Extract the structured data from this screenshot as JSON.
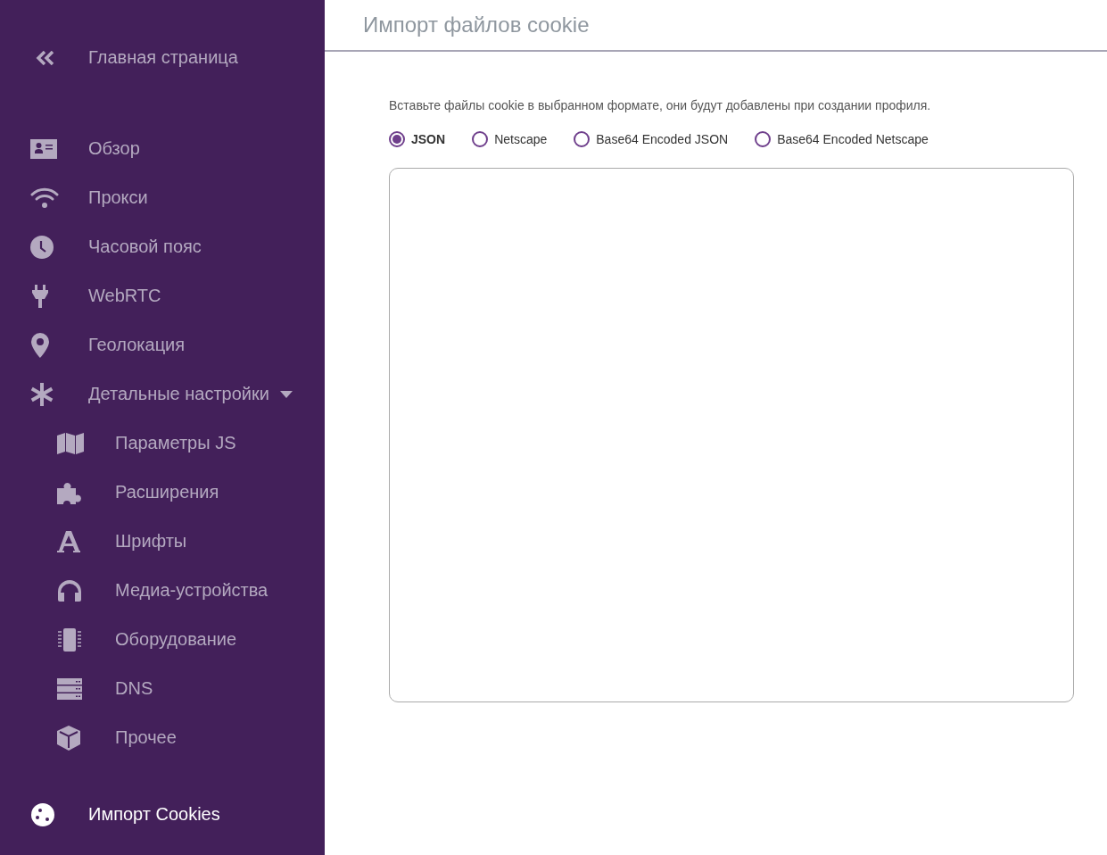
{
  "sidebar": {
    "back": {
      "label": "Главная страница"
    },
    "items": [
      {
        "label": "Обзор",
        "selected": false
      },
      {
        "label": "Прокси",
        "selected": false
      },
      {
        "label": "Часовой пояс",
        "selected": false
      },
      {
        "label": "WebRTC",
        "selected": false
      },
      {
        "label": "Геолокация",
        "selected": false
      },
      {
        "label": "Детальные настройки",
        "selected": false,
        "expanded": true,
        "children": [
          {
            "label": "Параметры JS",
            "selected": false
          },
          {
            "label": "Расширения",
            "selected": false
          },
          {
            "label": "Шрифты",
            "selected": false
          },
          {
            "label": "Медиа-устройства",
            "selected": false
          },
          {
            "label": "Оборудование",
            "selected": false
          },
          {
            "label": "DNS",
            "selected": false
          },
          {
            "label": "Прочее",
            "selected": false
          }
        ]
      }
    ],
    "bottom_item": {
      "label": "Импорт Cookies",
      "selected": true
    }
  },
  "main": {
    "title": "Импорт файлов cookie",
    "description": "Вставьте файлы cookie в выбранном формате, они будут добавлены при создании профиля.",
    "formats": [
      {
        "label": "JSON",
        "selected": true
      },
      {
        "label": "Netscape",
        "selected": false
      },
      {
        "label": "Base64 Encoded JSON",
        "selected": false
      },
      {
        "label": "Base64 Encoded Netscape",
        "selected": false
      }
    ]
  }
}
